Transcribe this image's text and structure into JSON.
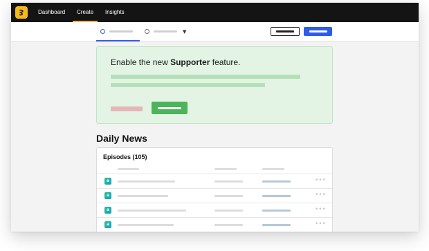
{
  "nav": {
    "items": [
      {
        "label": "Dashboard",
        "active": false
      },
      {
        "label": "Create",
        "active": true
      },
      {
        "label": "Insights",
        "active": false
      }
    ],
    "accent": "#f5b91e"
  },
  "toolbar": {
    "tabs": [
      {
        "selected": true,
        "has_dropdown": false
      },
      {
        "selected": false,
        "has_dropdown": true
      }
    ],
    "primary_color": "#2f5bea"
  },
  "promo": {
    "text_prefix": "Enable the new ",
    "text_bold": "Supporter",
    "text_suffix": " feature.",
    "background": "#e3f4e5",
    "button_color": "#4cb45b"
  },
  "show": {
    "title": "Daily News"
  },
  "episodes": {
    "title": "Episodes (105)",
    "rows": [
      {
        "icon": "episode-icon"
      },
      {
        "icon": "episode-icon"
      },
      {
        "icon": "episode-icon"
      },
      {
        "icon": "episode-icon"
      }
    ]
  }
}
